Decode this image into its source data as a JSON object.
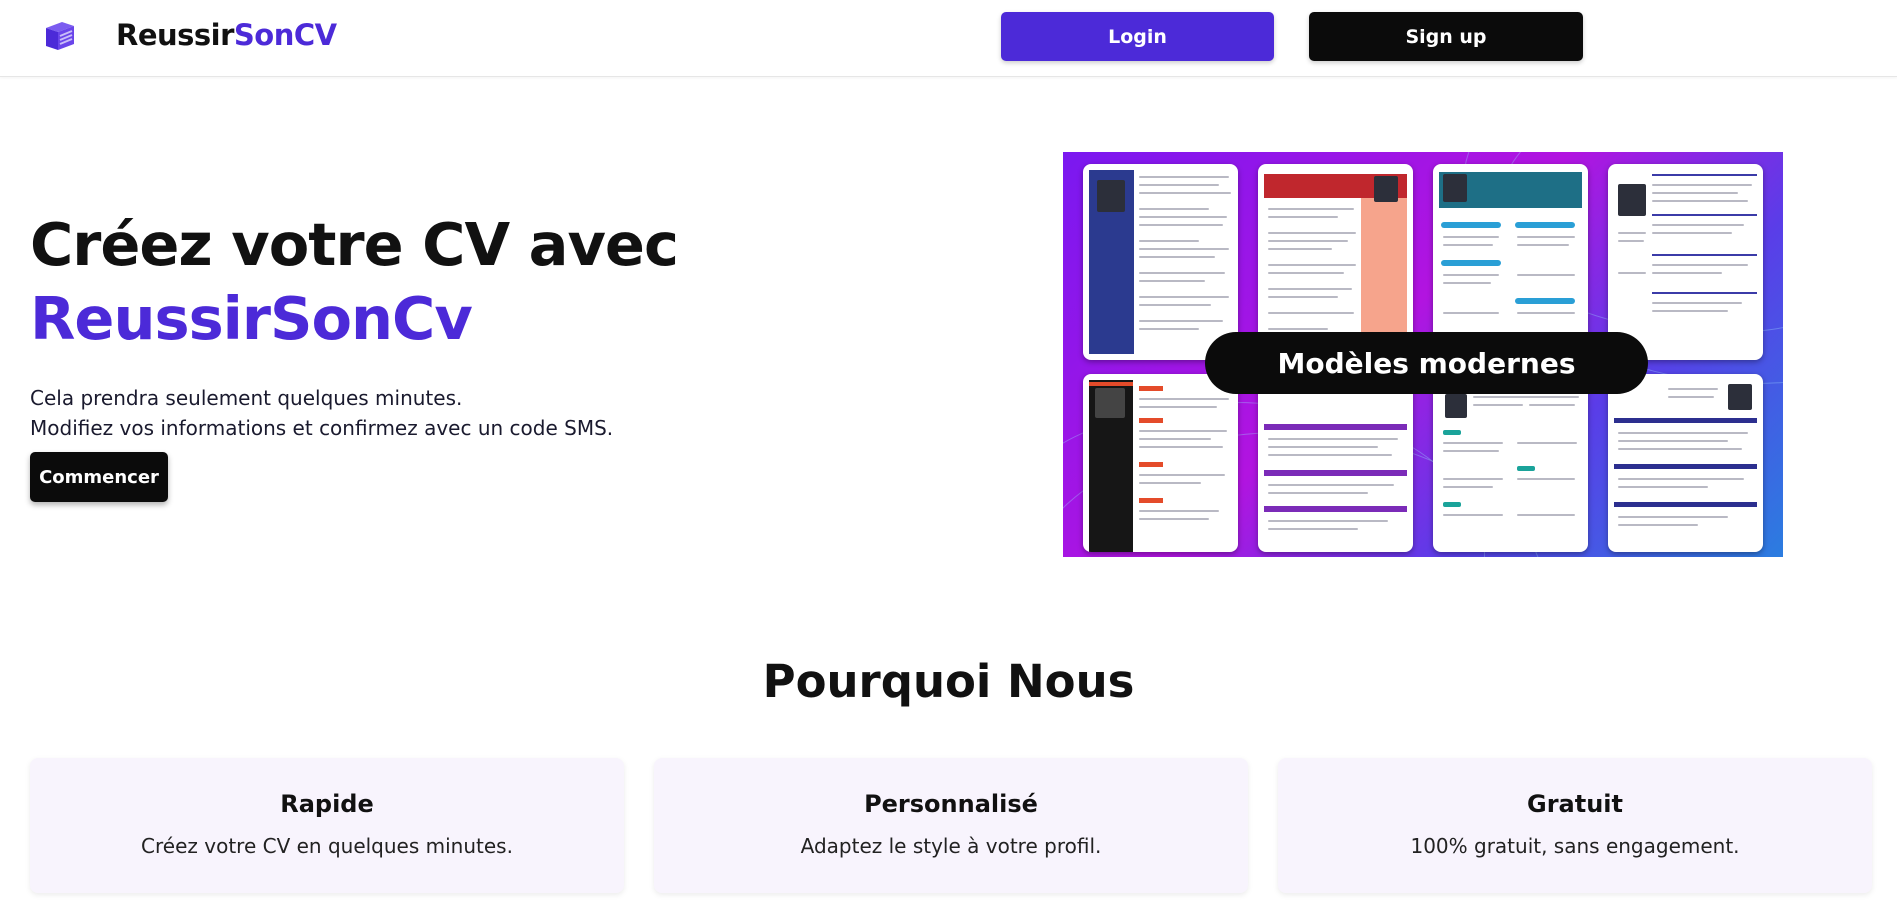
{
  "header": {
    "brand_part1": "Reussir",
    "brand_part2": "SonCV",
    "login_label": "Login",
    "signup_label": "Sign up"
  },
  "hero": {
    "title_line1": "Créez votre CV avec",
    "title_line2": "ReussirSonCv",
    "subtitle_line1": "Cela prendra seulement quelques minutes.",
    "subtitle_line2": "Modifiez vos informations et confirmez avec un code SMS.",
    "cta_label": "Commencer",
    "showcase_badge": "Modèles modernes"
  },
  "why": {
    "title": "Pourquoi Nous",
    "cards": [
      {
        "title": "Rapide",
        "desc": "Créez votre CV en quelques minutes."
      },
      {
        "title": "Personnalisé",
        "desc": "Adaptez le style à votre profil."
      },
      {
        "title": "Gratuit",
        "desc": "100% gratuit, sans engagement."
      }
    ]
  },
  "colors": {
    "accent": "#4c2ad8",
    "dark": "#0b0b0b",
    "card_bg": "#f8f4fd"
  },
  "icons": {
    "logo": "stacked-cards-logo-icon"
  }
}
